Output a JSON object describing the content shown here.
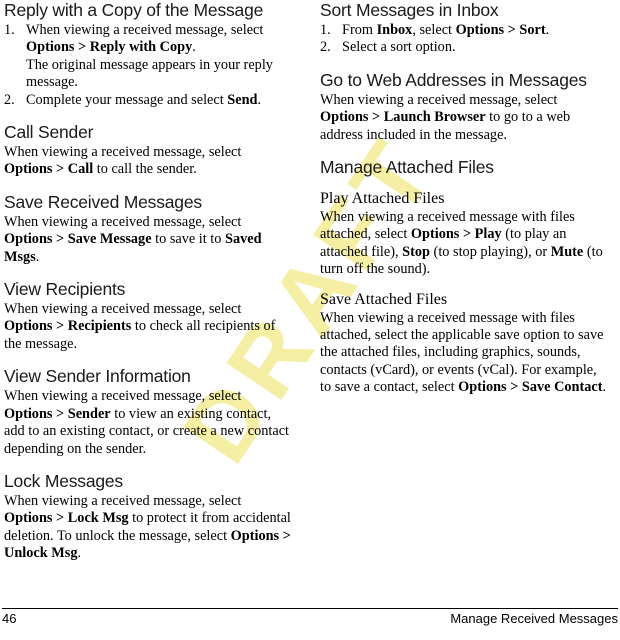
{
  "page": {
    "number": "46",
    "footer_title": "Manage Received Messages",
    "watermark": "DRAFT",
    "watermark_color": "#f4efa2"
  },
  "left_column": [
    {
      "heading": "Reply with a Copy of the Message",
      "type": "steps",
      "steps": [
        {
          "num": "1.",
          "lead": "When viewing a received message, select ",
          "bold1": "Options > Reply with Copy",
          "tail": ".",
          "note": "The original message appears in your reply message."
        },
        {
          "num": "2.",
          "lead": "Complete your message and select ",
          "bold1": "Send",
          "tail": "."
        }
      ]
    },
    {
      "heading": "Call Sender",
      "type": "paragraph",
      "lead": "When viewing a received message, select ",
      "bold1": "Options > Call",
      "tail": " to call the sender."
    },
    {
      "heading": "Save Received Messages",
      "type": "paragraph",
      "lead": "When viewing a received message, select ",
      "bold1": "Options > Save Message",
      "mid": " to save it to ",
      "bold2": "Saved Msgs",
      "tail": "."
    },
    {
      "heading": "View Recipients",
      "type": "paragraph",
      "lead": "When viewing a received message, select ",
      "bold1": "Options > Recipients",
      "tail": " to check all recipients of the message."
    },
    {
      "heading": "View Sender Information",
      "type": "paragraph",
      "lead": "When viewing a received message, select ",
      "bold1": "Options > Sender",
      "tail": " to view an existing contact, add to an existing contact, or create a new contact depending on the sender."
    },
    {
      "heading": "Lock Messages",
      "type": "paragraph",
      "lead": "When viewing a received message, select ",
      "bold1": "Options > Lock Msg",
      "mid": " to protect it from accidental deletion. To unlock the message, select ",
      "bold2": "Options > Unlock Msg",
      "tail": "."
    }
  ],
  "right_column": [
    {
      "heading": "Sort Messages in Inbox",
      "type": "steps",
      "steps": [
        {
          "num": "1.",
          "lead": "From ",
          "bold1": "Inbox",
          "mid": ", select ",
          "bold2": "Options > Sort",
          "tail": "."
        },
        {
          "num": "2.",
          "lead": "Select a sort option."
        }
      ]
    },
    {
      "heading": "Go to Web Addresses in Messages",
      "type": "paragraph",
      "lead": "When viewing a received message, select ",
      "bold1": "Options > Launch Browser",
      "tail": " to go to a web address included in the message."
    },
    {
      "heading": "Manage Attached Files",
      "type": "subsections",
      "subsections": [
        {
          "subheading": "Play Attached Files",
          "lead": "When viewing a received message with files attached, select ",
          "bold1": "Options > Play",
          "mid": " (to play an attached file), ",
          "bold2": "Stop",
          "mid2": " (to stop playing), or ",
          "bold3": "Mute",
          "tail": " (to turn off the sound)."
        },
        {
          "subheading": "Save Attached Files",
          "lead": "When viewing a received message with files attached, select the applicable save option to save the attached files, including graphics, sounds, contacts (vCard), or events (vCal). For example, to save a contact, select ",
          "bold1": "Options > Save Contact",
          "tail": "."
        }
      ]
    }
  ]
}
